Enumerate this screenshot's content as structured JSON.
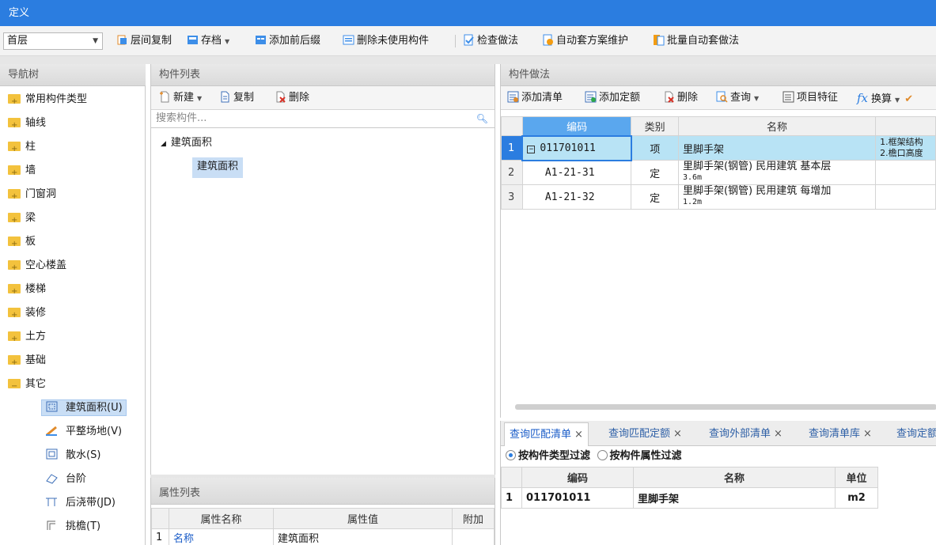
{
  "window": {
    "title": "定义"
  },
  "toolbar": {
    "floor_value": "首层",
    "buttons": [
      "层间复制",
      "存档",
      "添加前后缀",
      "删除未使用构件",
      "检查做法",
      "自动套方案维护",
      "批量自动套做法"
    ]
  },
  "nav": {
    "title": "导航树",
    "folders": [
      "常用构件类型",
      "轴线",
      "柱",
      "墙",
      "门窗洞",
      "梁",
      "板",
      "空心楼盖",
      "楼梯",
      "装修",
      "土方",
      "基础",
      "其它"
    ],
    "sub_items": [
      "建筑面积(U)",
      "平整场地(V)",
      "散水(S)",
      "台阶",
      "后浇带(JD)",
      "挑檐(T)"
    ]
  },
  "components": {
    "title": "构件列表",
    "toolbar": {
      "new": "新建",
      "copy": "复制",
      "delete": "删除"
    },
    "search_placeholder": "搜索构件...",
    "tree_parent": "建筑面积",
    "tree_child": "建筑面积"
  },
  "attributes": {
    "title": "属性列表",
    "headers": [
      "属性名称",
      "属性值",
      "附加"
    ],
    "rows": [
      {
        "num": "1",
        "name": "名称",
        "value": "建筑面积"
      }
    ]
  },
  "methods": {
    "title": "构件做法",
    "toolbar": [
      "添加清单",
      "添加定额",
      "删除",
      "查询",
      "项目特征",
      "换算"
    ],
    "headers": [
      "编码",
      "类别",
      "名称"
    ],
    "rows": [
      {
        "num": "1",
        "code": "011701011",
        "type": "项",
        "name": "里脚手架",
        "name_sub": "",
        "feature1": "1.框架结构",
        "feature2": "2.檐口高度"
      },
      {
        "num": "2",
        "code": "A1-21-31",
        "type": "定",
        "name": "里脚手架(钢管) 民用建筑 基本层",
        "name_sub": "3.6m",
        "feature1": "",
        "feature2": ""
      },
      {
        "num": "3",
        "code": "A1-21-32",
        "type": "定",
        "name": "里脚手架(钢管) 民用建筑 每增加",
        "name_sub": "1.2m",
        "feature1": "",
        "feature2": ""
      }
    ]
  },
  "query": {
    "tabs": [
      "查询匹配清单",
      "查询匹配定额",
      "查询外部清单",
      "查询清单库",
      "查询定额"
    ],
    "filter_type": "按构件类型过滤",
    "filter_attr": "按构件属性过滤",
    "headers": [
      "编码",
      "名称",
      "单位"
    ],
    "rows": [
      {
        "num": "1",
        "code": "011701011",
        "name": "里脚手架",
        "unit": "m2"
      }
    ]
  },
  "colors": {
    "titlebar": "#2b7de0",
    "selected_row": "#b8e3f5",
    "folder": "#f3c23d"
  }
}
